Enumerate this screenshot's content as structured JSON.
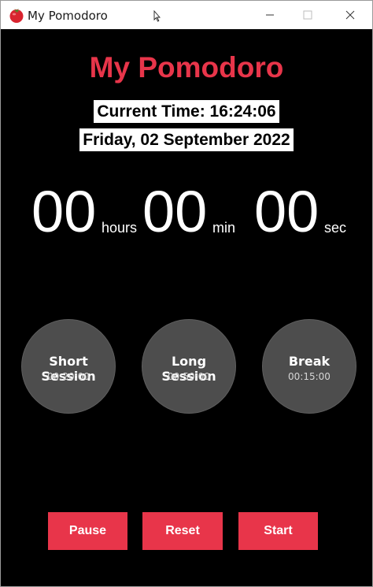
{
  "window": {
    "title": "My Pomodoro"
  },
  "app": {
    "heading": "My Pomodoro",
    "current_time": "Current Time: 16:24:06",
    "current_date": "Friday, 02 September 2022"
  },
  "timer": {
    "hours": "00",
    "hours_unit": "hours",
    "minutes": "00",
    "minutes_unit": "min",
    "seconds": "00",
    "seconds_unit": "sec"
  },
  "sessions": [
    {
      "label": "Short Session",
      "duration": "00:20:00"
    },
    {
      "label": "Long Session",
      "duration": "00:50:00"
    },
    {
      "label": "Break",
      "duration": "00:15:00"
    }
  ],
  "actions": {
    "pause": "Pause",
    "reset": "Reset",
    "start": "Start"
  },
  "colors": {
    "accent": "#e8354a",
    "background": "#000000",
    "session_circle": "#4d4d4d"
  },
  "icons": {
    "app": "tomato-icon",
    "minimize": "minimize-icon",
    "maximize": "maximize-icon",
    "close": "close-icon"
  }
}
